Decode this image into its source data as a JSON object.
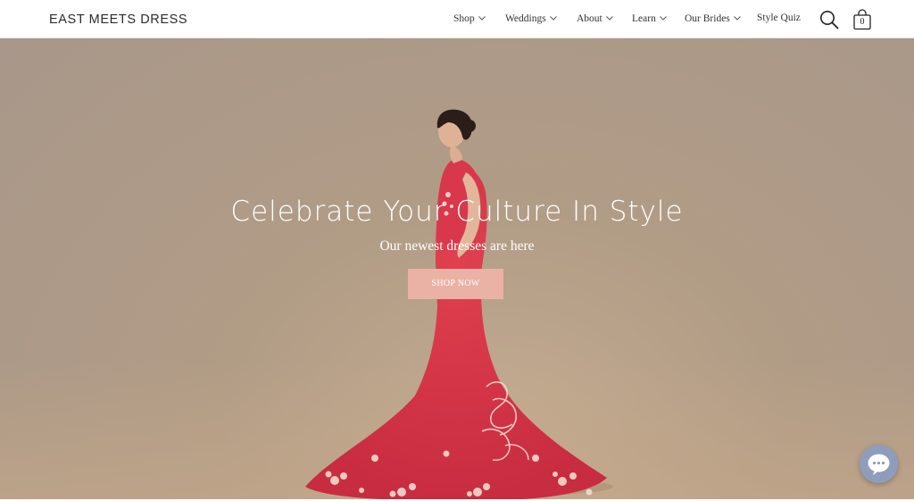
{
  "brand": {
    "logo_text": "EAST MEETS DRESS"
  },
  "nav": {
    "items": [
      {
        "label": "Shop",
        "has_dropdown": true
      },
      {
        "label": "Weddings",
        "has_dropdown": true
      },
      {
        "label": "About",
        "has_dropdown": true
      },
      {
        "label": "Learn",
        "has_dropdown": true
      },
      {
        "label": "Our Brides",
        "has_dropdown": true
      },
      {
        "label": "Style Quiz",
        "has_dropdown": false
      }
    ],
    "search_icon": "search-icon",
    "cart": {
      "icon": "shopping-bag-icon",
      "count": "0"
    }
  },
  "hero": {
    "title": "Celebrate Your Culture In Style",
    "subtitle": "Our newest dresses are here",
    "cta_label": "SHOP NOW",
    "image": "woman-in-red-embroidered-qipao-gown"
  },
  "chat": {
    "icon": "chat-bubble-icon"
  },
  "colors": {
    "hero_bg": "#ad9987",
    "cta_bg": "#eab2a4",
    "dress_red": "#d8344a",
    "chat_bg": "#8f9dbc"
  }
}
